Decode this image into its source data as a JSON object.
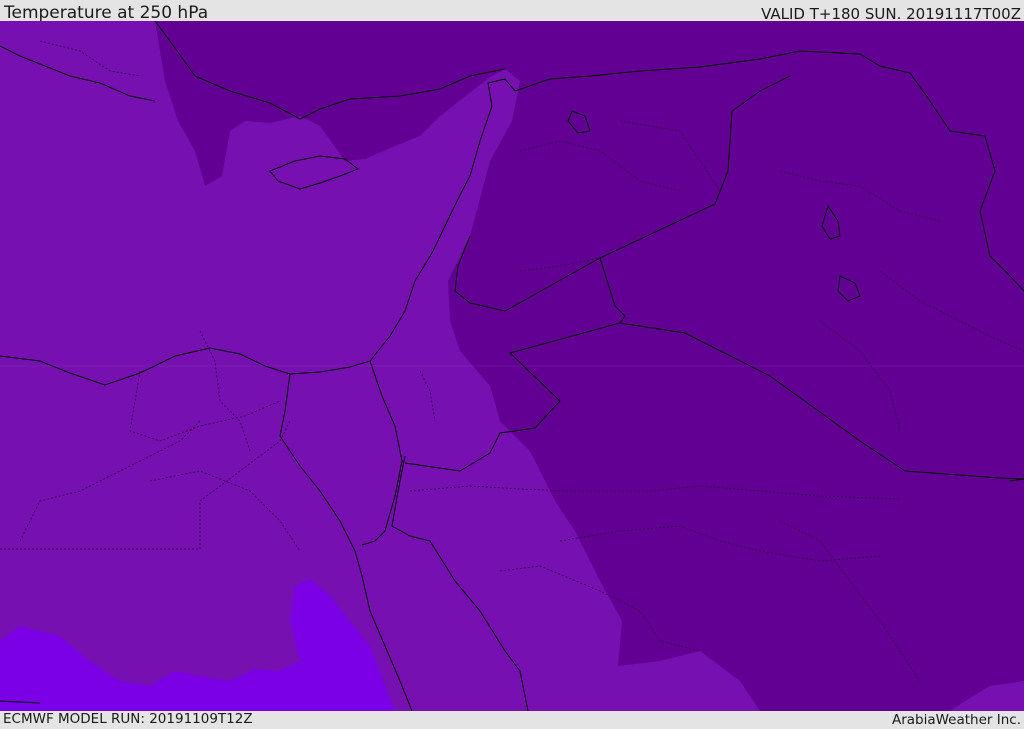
{
  "header": {
    "title": "Temperature at 250 hPa",
    "valid_time": "VALID T+180 SUN. 20191117T00Z"
  },
  "footer": {
    "model_run": "ECMWF MODEL RUN: 20191109T12Z",
    "credit": "ArabiaWeather Inc."
  },
  "colors": {
    "band_medium": "#7710b0",
    "band_dark": "#630094",
    "band_light": "#7b00e6",
    "coast_border": "#000000",
    "internal_border": "#2a0040"
  }
}
